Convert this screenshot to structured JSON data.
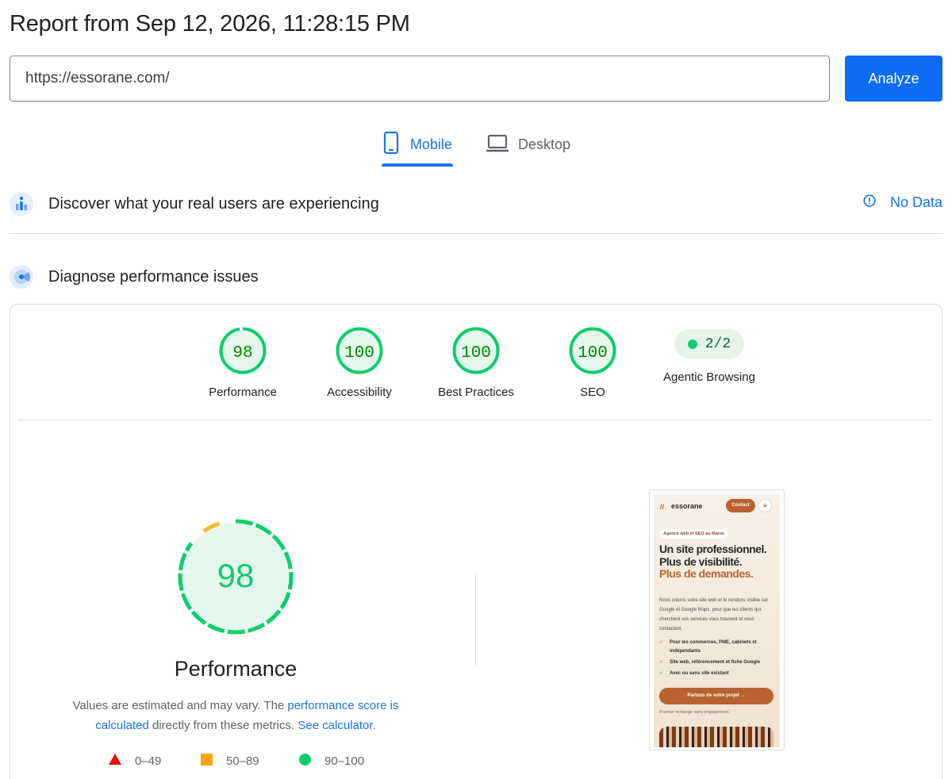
{
  "header": {
    "title": "Report from Sep 12, 2026, 11:28:15 PM"
  },
  "url_bar": {
    "value": "https://essorane.com/",
    "analyze_label": "Analyze"
  },
  "tabs": [
    {
      "label": "Mobile",
      "active": true,
      "icon": "smartphone-icon"
    },
    {
      "label": "Desktop",
      "active": false,
      "icon": "laptop-icon"
    }
  ],
  "crux_section": {
    "title": "Discover what your real users are experiencing",
    "status": "No Data",
    "status_icon": "info-icon"
  },
  "diagnose_section": {
    "title": "Diagnose performance issues"
  },
  "scores": [
    {
      "label": "Performance",
      "value": "98",
      "color": "#0cce6b"
    },
    {
      "label": "Accessibility",
      "value": "100",
      "color": "#0cce6b"
    },
    {
      "label": "Best Practices",
      "value": "100",
      "color": "#0cce6b"
    },
    {
      "label": "SEO",
      "value": "100",
      "color": "#0cce6b"
    },
    {
      "label": "Agentic Browsing",
      "value": "2/2",
      "color": "#0cce6b"
    }
  ],
  "performance_detail": {
    "score": "98",
    "heading": "Performance",
    "desc_part1": "Values are estimated and may vary. The ",
    "desc_link1": "performance score is calculated",
    "desc_part2": " directly from these metrics. ",
    "desc_link2": "See calculator",
    "desc_part3": "."
  },
  "legend": [
    {
      "range": "0–49",
      "shape": "triangle",
      "color": "#ff4e42"
    },
    {
      "range": "50–89",
      "shape": "square",
      "color": "#ffa400"
    },
    {
      "range": "90–100",
      "shape": "circle",
      "color": "#0cce6b"
    }
  ],
  "screenshot": {
    "logo": "essorane",
    "contact": "Contact",
    "badge": "Agence web et SEO au Maroc",
    "headline_1": "Un site professionnel.",
    "headline_2": "Plus de visibilité.",
    "headline_3": "Plus de demandes.",
    "paragraph": "Nous créons votre site web et le rendons visible sur Google et Google Maps, pour que les clients qui cherchent vos services vous trouvent et vous contactent.",
    "bullets": [
      "Pour les commerces, PME, cabinets et indépendants",
      "Site web, référencement et fiche Google",
      "Avec ou sans site existant"
    ],
    "cta": "Parlons de votre projet →",
    "note": "Premier échange sans engagement."
  }
}
